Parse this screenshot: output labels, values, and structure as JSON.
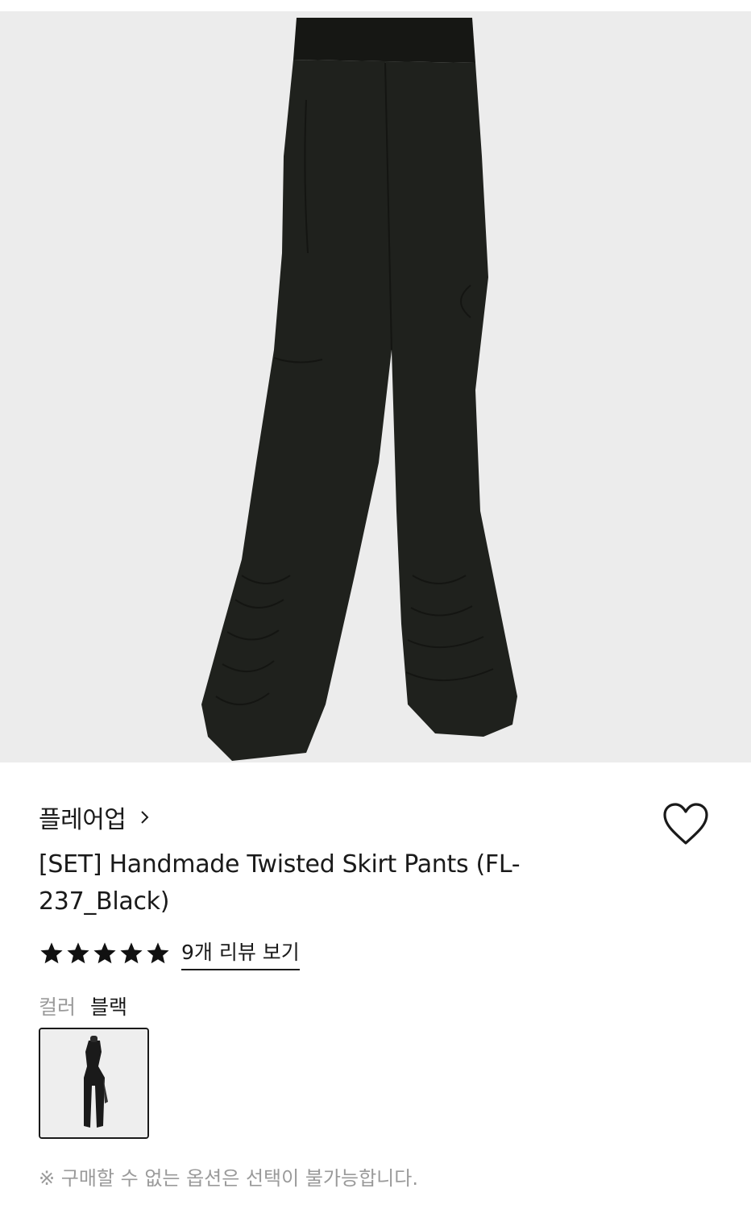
{
  "product": {
    "brand": "플레어업",
    "brand_chevron": "chevron-right-icon",
    "title": "[SET] Handmade Twisted Skirt Pants (FL-237_Black)",
    "rating_stars": 5,
    "review_link": "9개 리뷰 보기",
    "wishlist_icon": "heart-outline-icon"
  },
  "options": {
    "color_label": "컬러",
    "color_value": "블랙"
  },
  "notice": "※ 구매할 수 없는 옵션은 선택이 불가능합니다.",
  "colors": {
    "background": "#ffffff",
    "image_bg": "#ececec",
    "pants": "#1f211d",
    "text": "#1a1a1a",
    "muted": "#9a9a9a",
    "star": "#111111"
  }
}
